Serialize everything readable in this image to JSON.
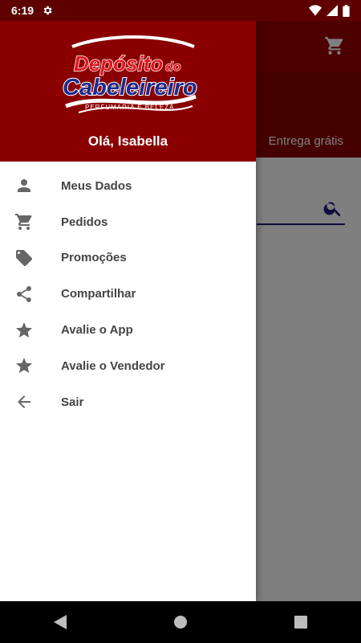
{
  "status_bar": {
    "time": "6:19"
  },
  "app": {
    "band_text": "Entrega grátis"
  },
  "drawer": {
    "logo": {
      "line1": "Depósito",
      "line1b": "do",
      "line2": "Cabeleireiro",
      "tagline": "PERFUMARIA E BELEZA"
    },
    "greeting": "Olá, Isabella",
    "items": [
      {
        "label": "Meus Dados",
        "icon": "person-icon"
      },
      {
        "label": "Pedidos",
        "icon": "cart-icon"
      },
      {
        "label": "Promoções",
        "icon": "tag-icon"
      },
      {
        "label": "Compartilhar",
        "icon": "share-icon"
      },
      {
        "label": "Avalie o App",
        "icon": "star-icon"
      },
      {
        "label": "Avalie o Vendedor",
        "icon": "star-icon"
      },
      {
        "label": "Sair",
        "icon": "arrow-back-icon"
      }
    ]
  },
  "colors": {
    "status_bar": "#5e0000",
    "header": "#8a0000",
    "icon_gray": "#666666",
    "label_gray": "#444444"
  }
}
